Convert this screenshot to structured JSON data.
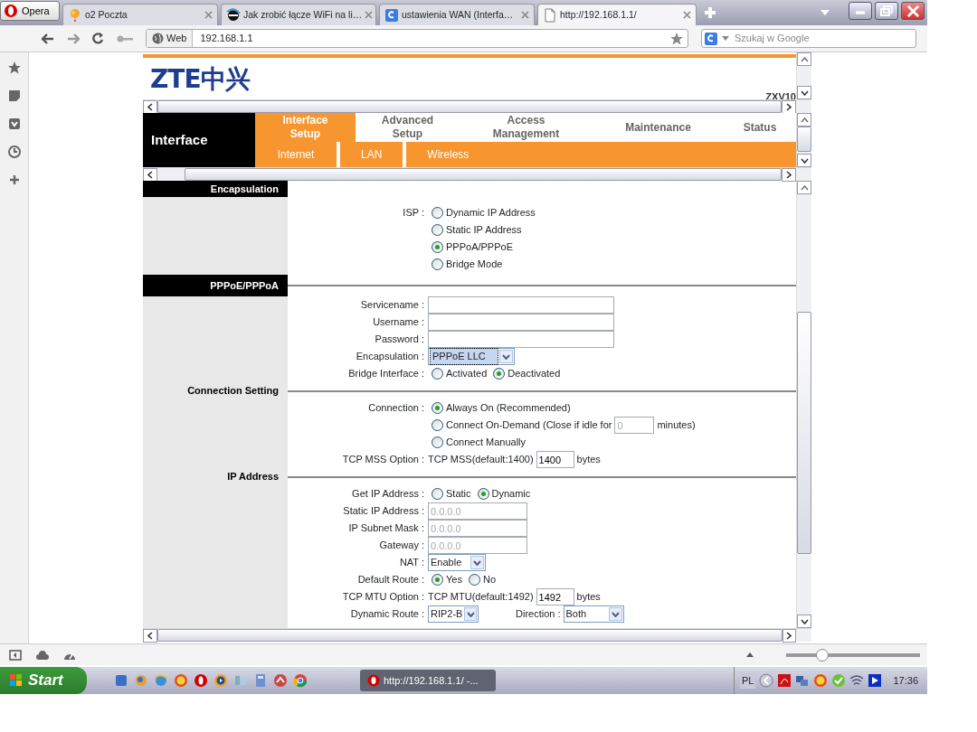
{
  "browser": {
    "menu_button": "Opera",
    "tabs": [
      {
        "label": "o2 Poczta",
        "selected": false
      },
      {
        "label": "Jak zrobić łącze WiFi na li…",
        "selected": false
      },
      {
        "label": "ustawienia WAN (Interfa…",
        "selected": false
      },
      {
        "label": "http://192.168.1.1/",
        "selected": true
      }
    ],
    "address": {
      "scope": "Web",
      "url": "192.168.1.1"
    },
    "search": {
      "placeholder": "Szukaj w Google"
    },
    "zoom": {
      "level": 0.27
    }
  },
  "router": {
    "logo": "ZTE中兴",
    "model": "ZXV10",
    "area": "Interface",
    "menu": [
      {
        "label": "Interface Setup",
        "selected": true
      },
      {
        "label": "Advanced Setup",
        "selected": false
      },
      {
        "label": "Access Management",
        "selected": false
      },
      {
        "label": "Maintenance",
        "selected": false
      },
      {
        "label": "Status",
        "selected": false
      }
    ],
    "submenu": [
      "Internet",
      "LAN",
      "Wireless"
    ],
    "sections": [
      {
        "title": "Encapsulation",
        "kind": "banner",
        "rows": [
          {
            "label": "ISP :",
            "controls": [
              {
                "kind": "radio",
                "label": "Dynamic IP Address",
                "checked": false
              }
            ]
          },
          {
            "controls": [
              {
                "kind": "radio",
                "label": "Static IP Address",
                "checked": false
              }
            ]
          },
          {
            "controls": [
              {
                "kind": "radio",
                "label": "PPPoA/PPPoE",
                "checked": true
              }
            ]
          },
          {
            "controls": [
              {
                "kind": "radio",
                "label": "Bridge Mode",
                "checked": false
              }
            ]
          }
        ]
      },
      {
        "title": "PPPoE/PPPoA",
        "kind": "banner",
        "rows": [
          {
            "label": "Servicename :",
            "controls": [
              {
                "kind": "text"
              }
            ]
          },
          {
            "label": "Username :",
            "controls": [
              {
                "kind": "text"
              }
            ]
          },
          {
            "label": "Password :",
            "controls": [
              {
                "kind": "text"
              }
            ]
          },
          {
            "label": "Encapsulation :",
            "controls": [
              {
                "kind": "select",
                "value": "PPPoE LLC",
                "focused": true
              }
            ]
          },
          {
            "label": "Bridge Interface :",
            "controls": [
              {
                "kind": "radio",
                "label": "Activated",
                "checked": false
              },
              {
                "kind": "radio",
                "label": "Deactivated",
                "checked": true
              }
            ]
          }
        ]
      },
      {
        "title": "Connection Setting",
        "kind": "plain",
        "rows": [
          {
            "label": "Connection :",
            "controls": [
              {
                "kind": "radio",
                "label": "Always On (Recommended)",
                "checked": true
              }
            ]
          },
          {
            "controls": [
              {
                "kind": "radio",
                "label": "Connect On-Demand (Close if idle for",
                "checked": false
              },
              {
                "kind": "text",
                "value": "0",
                "disabled": true
              },
              {
                "kind": "note",
                "text": "minutes)"
              }
            ]
          },
          {
            "controls": [
              {
                "kind": "radio",
                "label": "Connect Manually",
                "checked": false
              }
            ]
          },
          {
            "label": "TCP MSS Option :",
            "controls": [
              {
                "kind": "note",
                "text": "TCP MSS(default:1400)"
              },
              {
                "kind": "text",
                "value": "1400",
                "disabled": false
              },
              {
                "kind": "note",
                "text": "bytes"
              }
            ]
          }
        ]
      },
      {
        "title": "IP Address",
        "kind": "plain",
        "rows": [
          {
            "label": "Get IP Address :",
            "controls": [
              {
                "kind": "radio",
                "label": "Static",
                "checked": false
              },
              {
                "kind": "radio",
                "label": "Dynamic",
                "checked": true
              }
            ]
          },
          {
            "label": "Static IP Address :",
            "controls": [
              {
                "kind": "text",
                "value": "0.0.0.0",
                "disabled": true
              }
            ]
          },
          {
            "label": "IP Subnet Mask :",
            "controls": [
              {
                "kind": "text",
                "value": "0.0.0.0",
                "disabled": true
              }
            ]
          },
          {
            "label": "Gateway :",
            "controls": [
              {
                "kind": "text",
                "value": "0.0.0.0",
                "disabled": true
              }
            ]
          },
          {
            "label": "NAT :",
            "controls": [
              {
                "kind": "select",
                "value": "Enable",
                "focused": false
              }
            ]
          },
          {
            "label": "Default Route :",
            "controls": [
              {
                "kind": "radio",
                "label": "Yes",
                "checked": true
              },
              {
                "kind": "radio",
                "label": "No",
                "checked": false
              }
            ]
          },
          {
            "label": "TCP MTU Option :",
            "controls": [
              {
                "kind": "note",
                "text": "TCP MTU(default:1492)"
              },
              {
                "kind": "text",
                "value": "1492",
                "disabled": false
              },
              {
                "kind": "note",
                "text": "bytes"
              }
            ]
          },
          {
            "label": "Dynamic Route :",
            "controls": [
              {
                "kind": "select",
                "value": "RIP2-B",
                "focused": false
              },
              {
                "kind": "caption",
                "text": "Direction :"
              },
              {
                "kind": "select",
                "value": "Both",
                "focused": false
              }
            ]
          }
        ]
      }
    ]
  },
  "taskbar": {
    "start": "Start",
    "tasks": [
      "http://192.168.1.1/ -..."
    ],
    "language": "PL",
    "clock": "17:36"
  }
}
